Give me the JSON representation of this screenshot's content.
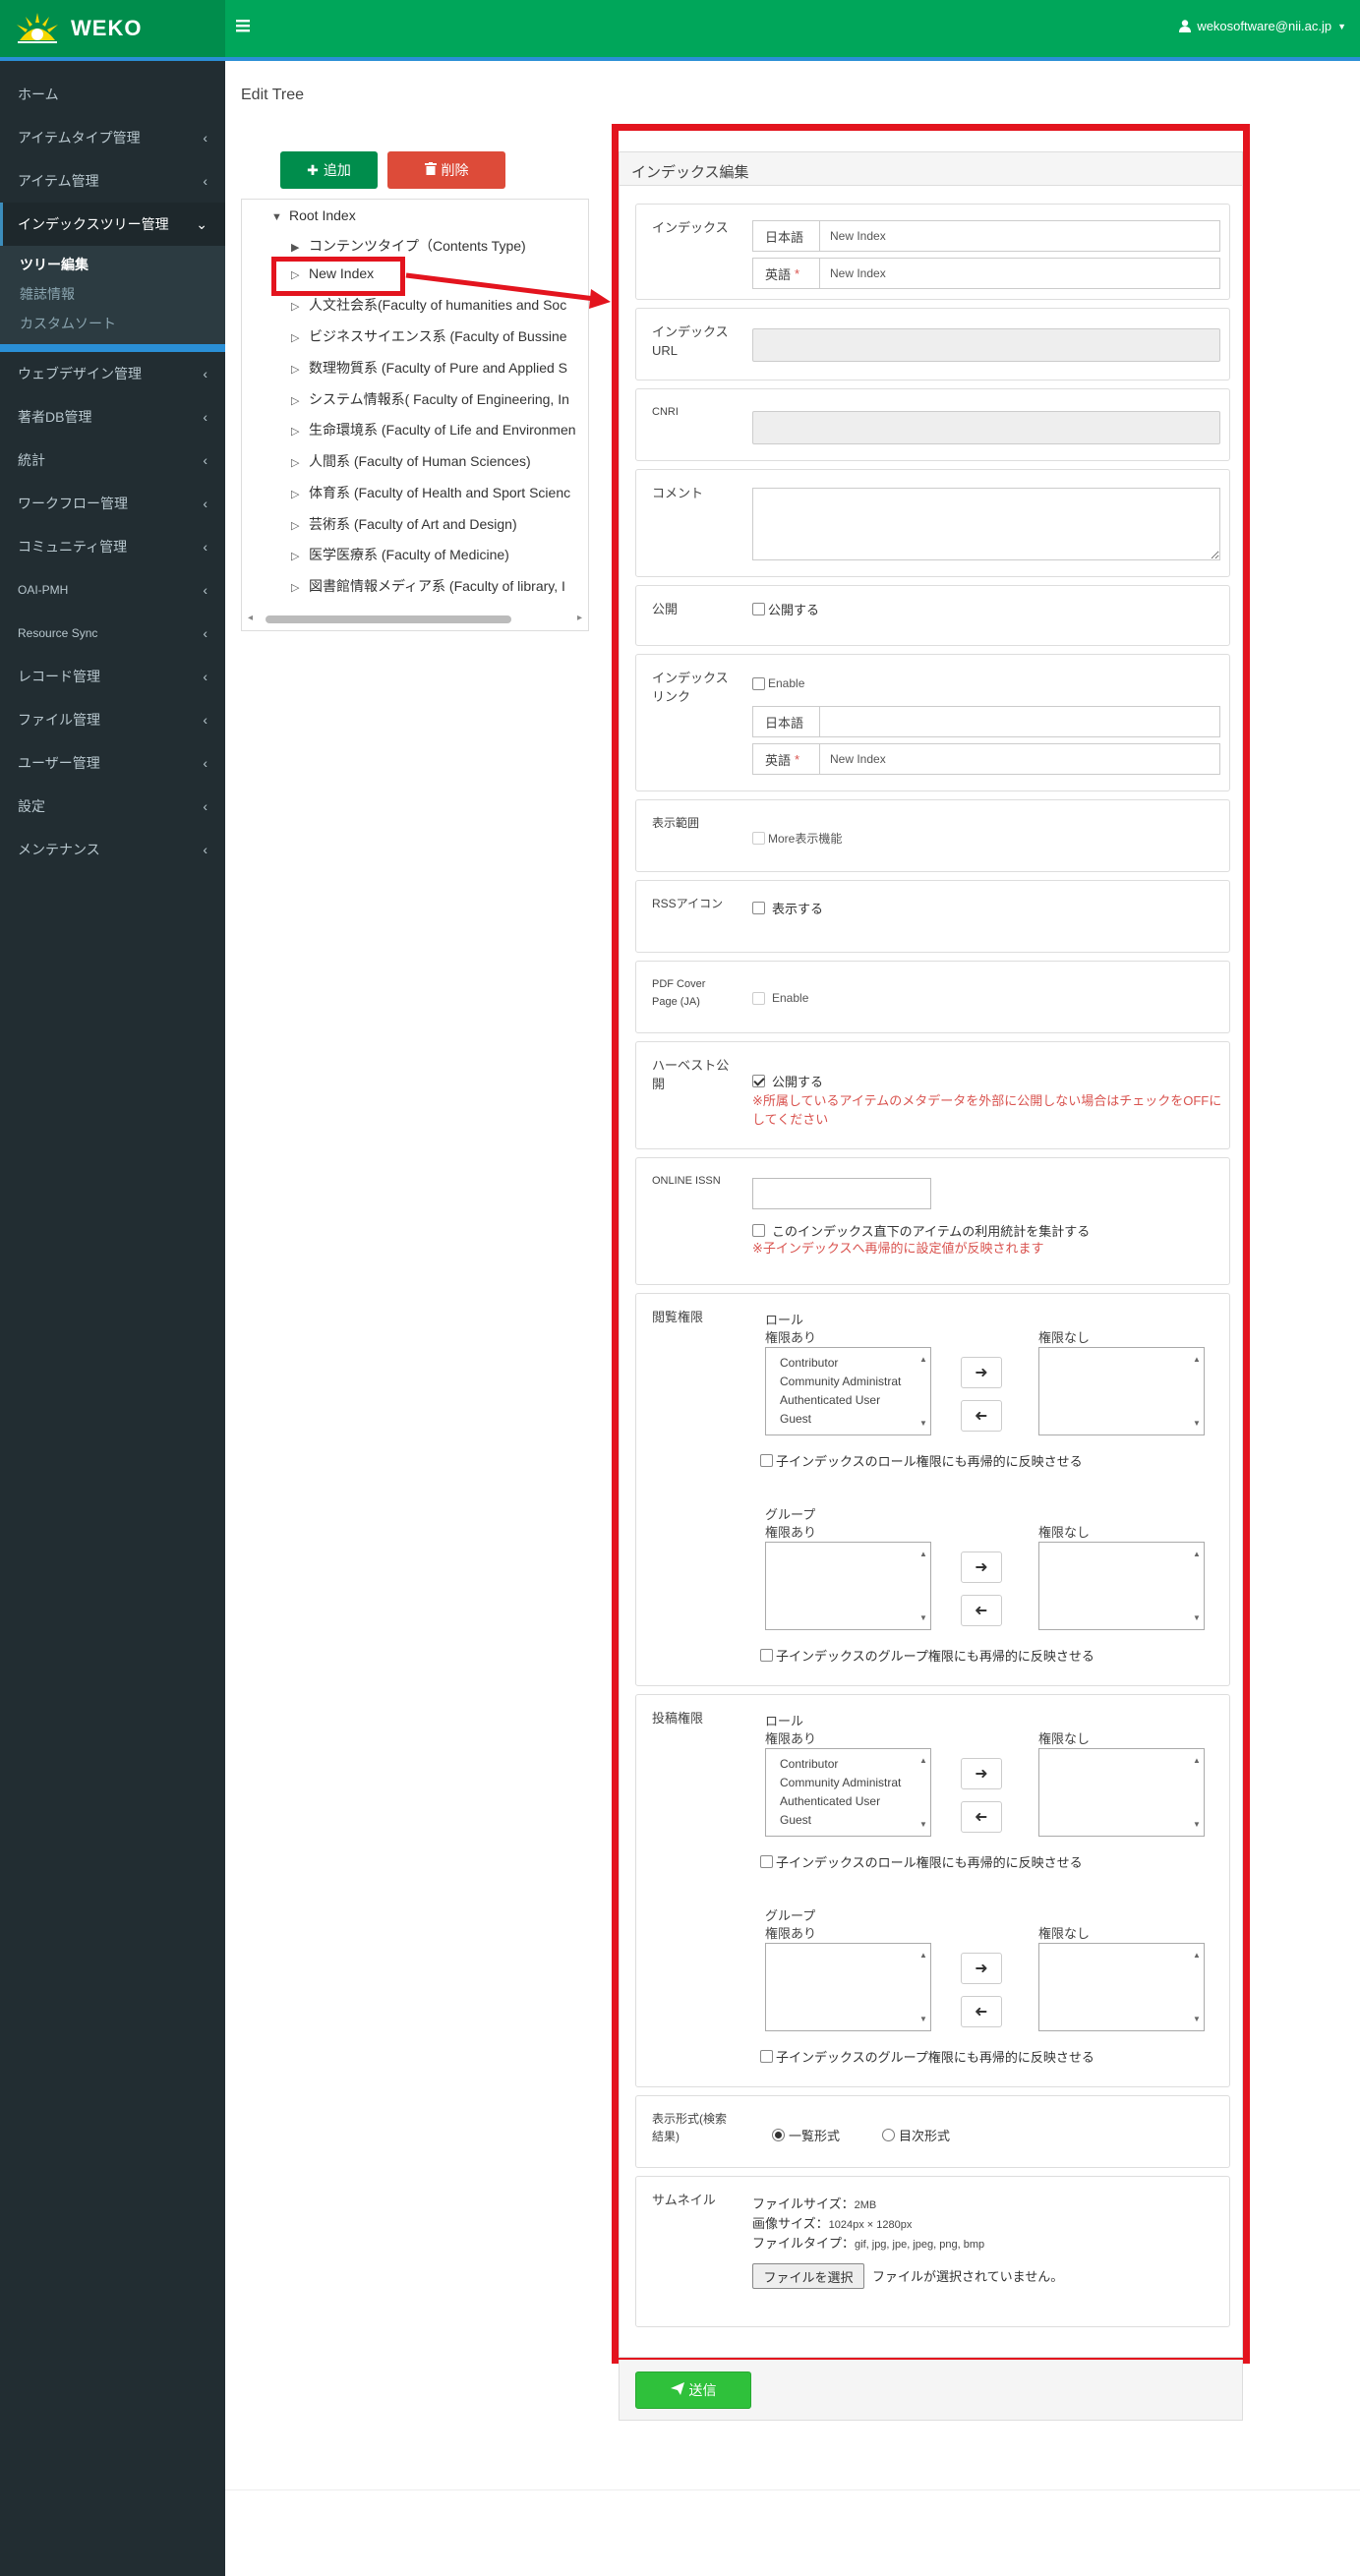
{
  "header": {
    "brand": "WEKO",
    "user": "wekosoftware@nii.ac.jp"
  },
  "sidebar": {
    "items": [
      {
        "label": "ホーム"
      },
      {
        "label": "アイテムタイプ管理"
      },
      {
        "label": "アイテム管理"
      },
      {
        "label": "インデックスツリー管理"
      },
      {
        "label": "ウェブデザイン管理"
      },
      {
        "label": "著者DB管理"
      },
      {
        "label": "統計"
      },
      {
        "label": "ワークフロー管理"
      },
      {
        "label": "コミュニティ管理"
      },
      {
        "label": "OAI-PMH"
      },
      {
        "label": "Resource Sync"
      },
      {
        "label": "レコード管理"
      },
      {
        "label": "ファイル管理"
      },
      {
        "label": "ユーザー管理"
      },
      {
        "label": "設定"
      },
      {
        "label": "メンテナンス"
      }
    ],
    "sub": [
      "ツリー編集",
      "雑誌情報",
      "カスタムソート"
    ]
  },
  "page": {
    "title": "Edit Tree",
    "add": "追加",
    "delete": "削除"
  },
  "tree": {
    "root": "Root Index",
    "nodes": [
      "コンテンツタイプ（Contents Type)",
      "New Index",
      "人文社会系(Faculty of humanities and Soc",
      "ビジネスサイエンス系 (Faculty of Bussine",
      "数理物質系 (Faculty of Pure and Applied S",
      "システム情報系( Faculty of Engineering, In",
      "生命環境系 (Faculty of Life and Environmen",
      "人間系 (Faculty of Human Sciences)",
      "体育系 (Faculty of Health and Sport Scienc",
      "芸術系 (Faculty of Art and Design)",
      "医学医療系 (Faculty of Medicine)",
      "図書館情報メディア系 (Faculty of library, I"
    ]
  },
  "form": {
    "heading": "インデックス編集",
    "index_label": "インデックス",
    "ja": "日本語",
    "en": "英語",
    "req": "*",
    "placeholder": "New Index",
    "url_label": "インデックスURL",
    "cnri_label": "CNRI",
    "comment_label": "コメント",
    "public_label": "公開",
    "public_cb": "公開する",
    "link_label": "インデックスリンク",
    "link_enable": "Enable",
    "display_range_label": "表示範囲",
    "more_label": "More表示機能",
    "rss_label": "RSSアイコン",
    "rss_cb": "表示する",
    "pdf_label": "PDF Cover Page (JA)",
    "pdf_enable": "Enable",
    "harvest_label": "ハーベスト公開",
    "harvest_cb": "公開する",
    "harvest_note": "※所属しているアイテムのメタデータを外部に公開しない場合はチェックをOFFにしてください",
    "issn_label": "ONLINE ISSN",
    "stats_cb": "このインデックス直下のアイテムの利用統計を集計する",
    "stats_note": "※子インデックスへ再帰的に設定値が反映されます",
    "browse_label": "閲覧権限",
    "contrib_label": "投稿権限",
    "role": "ロール",
    "group": "グループ",
    "allowed": "権限あり",
    "denied": "権限なし",
    "roles": [
      "Contributor",
      "Community Administrat",
      "Authenticated User",
      "Guest"
    ],
    "role_recursive": "子インデックスのロール権限にも再帰的に反映させる",
    "group_recursive": "子インデックスのグループ権限にも再帰的に反映させる",
    "format_label": "表示形式(検索結果)",
    "format_list": "一覧形式",
    "format_toc": "目次形式",
    "thumb_label": "サムネイル",
    "file_size": "ファイルサイズ：",
    "file_size_v": "2MB",
    "img_size": "画像サイズ：",
    "img_size_v": "1024px × 1280px",
    "file_type": "ファイルタイプ：",
    "file_type_v": "gif, jpg, jpe, jpeg, png, bmp",
    "choose": "ファイルを選択",
    "no_file": "ファイルが選択されていません。",
    "submit": "送信"
  }
}
